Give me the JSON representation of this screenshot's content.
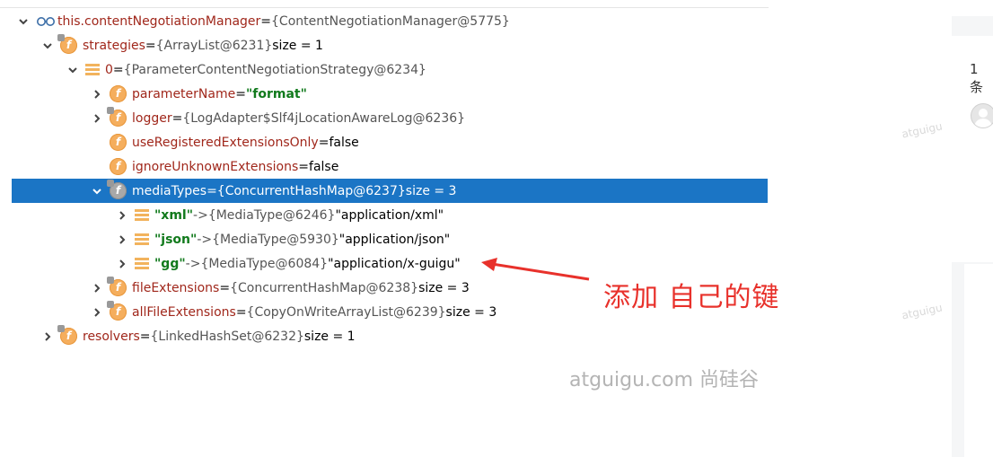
{
  "tree": {
    "rows": [
      {
        "name": "this.contentNegotiationManager",
        "eq": " = ",
        "ref": "{ContentNegotiationManager@5775}",
        "after": ""
      },
      {
        "name": "strategies",
        "eq": " = ",
        "ref": "{ArrayList@6231}",
        "after": "  size = 1"
      },
      {
        "name": "0",
        "eq": " = ",
        "ref": "{ParameterContentNegotiationStrategy@6234}",
        "after": ""
      },
      {
        "name": "parameterName",
        "eq": " = ",
        "str": "\"format\"",
        "after": ""
      },
      {
        "name": "logger",
        "eq": " = ",
        "ref": "{LogAdapter$Slf4jLocationAwareLog@6236}",
        "after": ""
      },
      {
        "name": "useRegisteredExtensionsOnly",
        "eq": " = ",
        "after": "false"
      },
      {
        "name": "ignoreUnknownExtensions",
        "eq": " = ",
        "after": "false"
      },
      {
        "name": "mediaTypes",
        "eq": " = ",
        "ref": "{ConcurrentHashMap@6237}",
        "after": "  size = 3"
      },
      {
        "key": "\"xml\"",
        "arrow": " -> ",
        "ref": "{MediaType@6246}",
        "after": " \"application/xml\""
      },
      {
        "key": "\"json\"",
        "arrow": " -> ",
        "ref": "{MediaType@5930}",
        "after": " \"application/json\""
      },
      {
        "key": "\"gg\"",
        "arrow": " -> ",
        "ref": "{MediaType@6084}",
        "after": " \"application/x-guigu\""
      },
      {
        "name": "fileExtensions",
        "eq": " = ",
        "ref": "{ConcurrentHashMap@6238}",
        "after": "  size = 3"
      },
      {
        "name": "allFileExtensions",
        "eq": " = ",
        "ref": "{CopyOnWriteArrayList@6239}",
        "after": "  size = 3"
      },
      {
        "name": "resolvers",
        "eq": " = ",
        "ref": "{LinkedHashSet@6232}",
        "after": "  size = 1"
      }
    ]
  },
  "annotation": {
    "text": "添加 自己的键"
  },
  "brand": {
    "text": "atguigu.com 尚硅谷"
  },
  "watermark": {
    "text": "atguigu"
  },
  "sidebar": {
    "count_text": "1 条"
  },
  "colors": {
    "selection": "#1b75c5",
    "field_name": "#a0271b",
    "string_value": "#117a1c",
    "annotation": "#e8312b",
    "field_icon": "#f5ae5d"
  }
}
